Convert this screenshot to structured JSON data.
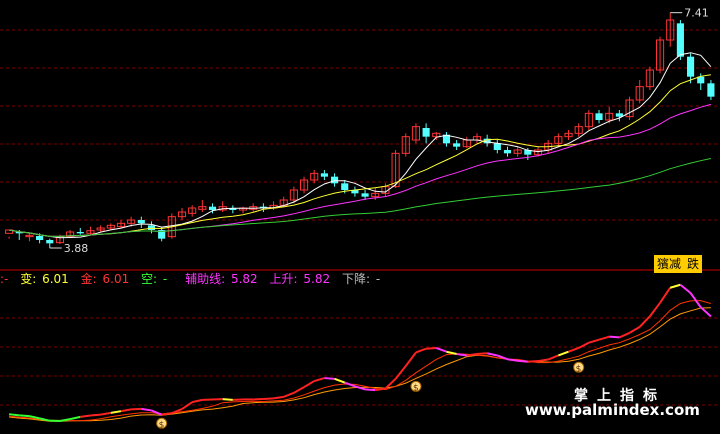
{
  "price_panel": {
    "high_label": "7.41",
    "low_label": "3.88",
    "buttons": {
      "a": "獱减",
      "b": "跌"
    }
  },
  "indicator_bar": {
    "prefix": ":-",
    "bian_label": "变:",
    "bian_value": "6.01",
    "jin_label": "金:",
    "jin_value": "6.01",
    "kong_label": "空:",
    "kong_value": "-",
    "aux_label": "辅助线:",
    "aux_value": "5.82",
    "up_label": "上升:",
    "up_value": "5.82",
    "down_label": "下降:",
    "down_value": "-"
  },
  "signal_marker": "$",
  "watermark": {
    "cn": "掌上指标",
    "url": "www.palmindex.com"
  },
  "colors": {
    "up_candle": "#ff3333",
    "down_candle": "#54ffff",
    "ma_white": "#ffffff",
    "ma_yellow": "#ffff33",
    "ma_magenta": "#ff33ff",
    "ma_green": "#33cc33",
    "grid_red": "#7a0000"
  },
  "chart_data": {
    "type": "candlestick",
    "price_high": 7.41,
    "price_low": 3.88,
    "candles": [
      [
        4.1,
        4.15,
        4.05,
        4.02
      ],
      [
        4.12,
        4.1,
        4.0,
        4.15
      ],
      [
        4.05,
        4.07,
        3.98,
        4.1
      ],
      [
        4.06,
        4.0,
        3.95,
        4.1
      ],
      [
        4.0,
        3.95,
        3.88,
        4.02
      ],
      [
        3.96,
        4.05,
        3.94,
        4.08
      ],
      [
        4.05,
        4.12,
        4.03,
        4.15
      ],
      [
        4.12,
        4.1,
        4.08,
        4.18
      ],
      [
        4.1,
        4.14,
        4.08,
        4.2
      ],
      [
        4.15,
        4.18,
        4.12,
        4.22
      ],
      [
        4.18,
        4.22,
        4.15,
        4.25
      ],
      [
        4.2,
        4.25,
        4.18,
        4.3
      ],
      [
        4.25,
        4.3,
        4.2,
        4.35
      ],
      [
        4.3,
        4.25,
        4.18,
        4.35
      ],
      [
        4.22,
        4.15,
        4.1,
        4.28
      ],
      [
        4.15,
        4.02,
        3.98,
        4.2
      ],
      [
        4.05,
        4.35,
        4.02,
        4.4
      ],
      [
        4.35,
        4.42,
        4.3,
        4.48
      ],
      [
        4.4,
        4.48,
        4.35,
        4.52
      ],
      [
        4.46,
        4.5,
        4.42,
        4.6
      ],
      [
        4.5,
        4.45,
        4.4,
        4.55
      ],
      [
        4.45,
        4.5,
        4.42,
        4.58
      ],
      [
        4.48,
        4.45,
        4.4,
        4.52
      ],
      [
        4.45,
        4.48,
        4.4,
        4.5
      ],
      [
        4.46,
        4.5,
        4.42,
        4.55
      ],
      [
        4.5,
        4.48,
        4.42,
        4.55
      ],
      [
        4.48,
        4.52,
        4.45,
        4.58
      ],
      [
        4.52,
        4.6,
        4.5,
        4.65
      ],
      [
        4.6,
        4.75,
        4.55,
        4.8
      ],
      [
        4.75,
        4.9,
        4.7,
        4.95
      ],
      [
        4.9,
        5.0,
        4.85,
        5.05
      ],
      [
        5.0,
        4.95,
        4.9,
        5.05
      ],
      [
        4.95,
        4.85,
        4.8,
        5.0
      ],
      [
        4.85,
        4.75,
        4.7,
        4.9
      ],
      [
        4.75,
        4.7,
        4.65,
        4.8
      ],
      [
        4.7,
        4.65,
        4.6,
        4.75
      ],
      [
        4.65,
        4.7,
        4.6,
        4.78
      ],
      [
        4.7,
        4.8,
        4.65,
        4.85
      ],
      [
        4.8,
        5.3,
        4.78,
        5.35
      ],
      [
        5.3,
        5.55,
        5.25,
        5.6
      ],
      [
        5.5,
        5.7,
        5.45,
        5.75
      ],
      [
        5.68,
        5.55,
        5.45,
        5.75
      ],
      [
        5.55,
        5.6,
        5.5,
        5.62
      ],
      [
        5.58,
        5.45,
        5.4,
        5.62
      ],
      [
        5.45,
        5.4,
        5.35,
        5.5
      ],
      [
        5.4,
        5.5,
        5.38,
        5.55
      ],
      [
        5.5,
        5.55,
        5.45,
        5.6
      ],
      [
        5.52,
        5.45,
        5.4,
        5.58
      ],
      [
        5.45,
        5.35,
        5.3,
        5.5
      ],
      [
        5.35,
        5.3,
        5.25,
        5.4
      ],
      [
        5.3,
        5.35,
        5.25,
        5.4
      ],
      [
        5.35,
        5.28,
        5.2,
        5.38
      ],
      [
        5.28,
        5.35,
        5.25,
        5.4
      ],
      [
        5.35,
        5.45,
        5.3,
        5.5
      ],
      [
        5.45,
        5.55,
        5.4,
        5.6
      ],
      [
        5.55,
        5.6,
        5.5,
        5.65
      ],
      [
        5.6,
        5.7,
        5.55,
        5.75
      ],
      [
        5.7,
        5.9,
        5.65,
        5.95
      ],
      [
        5.9,
        5.8,
        5.75,
        5.95
      ],
      [
        5.8,
        5.9,
        5.75,
        6.0
      ],
      [
        5.9,
        5.85,
        5.78,
        5.95
      ],
      [
        5.85,
        6.1,
        5.8,
        6.15
      ],
      [
        6.1,
        6.3,
        6.05,
        6.4
      ],
      [
        6.3,
        6.55,
        6.25,
        6.6
      ],
      [
        6.55,
        7.0,
        6.5,
        7.05
      ],
      [
        7.0,
        7.3,
        6.9,
        7.41
      ],
      [
        7.25,
        6.75,
        6.7,
        7.3
      ],
      [
        6.75,
        6.45,
        6.35,
        6.8
      ],
      [
        6.45,
        6.35,
        6.25,
        6.5
      ],
      [
        6.35,
        6.15,
        6.1,
        6.4
      ]
    ]
  }
}
